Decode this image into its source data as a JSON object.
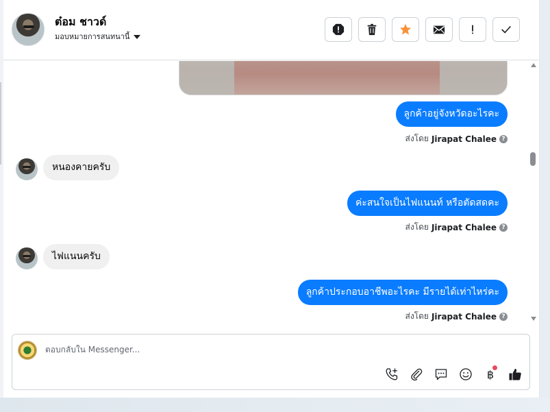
{
  "header": {
    "contact_name": "ต๋อม ชาวด์",
    "assign_label": "มอบหมายการสนทนานี้",
    "actions": [
      {
        "name": "mark-spam-button",
        "icon": "alert-octagon-icon"
      },
      {
        "name": "delete-button",
        "icon": "trash-icon"
      },
      {
        "name": "star-button",
        "icon": "star-icon",
        "color": "#f7923a"
      },
      {
        "name": "mark-unread-button",
        "icon": "envelope-icon"
      },
      {
        "name": "follow-up-button",
        "icon": "exclamation-icon"
      },
      {
        "name": "mark-done-button",
        "icon": "checkmark-icon"
      }
    ]
  },
  "messages": [
    {
      "direction": "out",
      "text": "ลูกค้าอยู่จังหวัดอะไรคะ",
      "sent_by_prefix": "ส่งโดย",
      "sent_by": "Jirapat Chalee"
    },
    {
      "direction": "in",
      "text": "หนองคายครับ"
    },
    {
      "direction": "out",
      "text": "ค่ะสนใจเป็นไฟแนนท์ หรือตัดสดคะ",
      "sent_by_prefix": "ส่งโดย",
      "sent_by": "Jirapat Chalee"
    },
    {
      "direction": "in",
      "text": "ไฟแนนครับ"
    },
    {
      "direction": "out",
      "text": "ลูกค้าประกอบอาชีพอะไรคะ มีรายได้เท่าไหร่คะ",
      "sent_by_prefix": "ส่งโดย",
      "sent_by": "Jirapat Chalee"
    }
  ],
  "composer": {
    "placeholder": "ตอบกลับใน Messenger...",
    "tools": [
      "phone-plus-icon",
      "paperclip-icon",
      "chat-bubble-icon",
      "smiley-icon",
      "baht-icon",
      "thumbs-up-icon"
    ],
    "baht_symbol": "฿"
  },
  "colors": {
    "outgoing_bubble": "#0a7cff",
    "incoming_bubble": "#f0f0f0",
    "star": "#f7923a",
    "notification_dot": "#e84a5f"
  }
}
